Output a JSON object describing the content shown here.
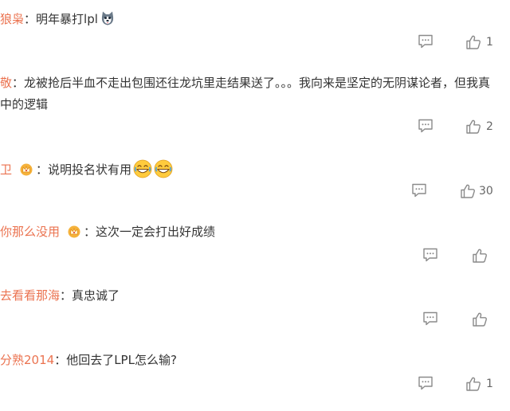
{
  "comments": [
    {
      "user": "狼枭",
      "sep": "：",
      "text": "明年暴打lpl",
      "text2": "",
      "likes": "1"
    },
    {
      "user": "敬",
      "sep": "：",
      "text": "龙被抢后半血不走出包围还往龙坑里走结果送了。。。我向来是坚定的无阴谋论者，但我真",
      "text2": "中的逻辑",
      "likes": "2"
    },
    {
      "user": "卫",
      "sep": "：",
      "text": "说明投名状有用",
      "text2": "",
      "likes": "30"
    },
    {
      "user": "你那么没用",
      "sep": "：",
      "text": "这次一定会打出好成绩",
      "text2": "",
      "likes": ""
    },
    {
      "user": "去看看那海",
      "sep": "：",
      "text": "真忠诚了",
      "text2": "",
      "likes": ""
    },
    {
      "user": "分熟2014",
      "sep": "：",
      "text": "他回去了LPL怎么输?",
      "text2": "",
      "likes": "1"
    }
  ],
  "icons": {
    "reply": "comment-bubble-icon",
    "like": "thumbs-up-icon",
    "badge": "crown-badge-icon",
    "emoji": "grinning-emoji-icon",
    "avatar_sticker": "husky-emoji-icon"
  },
  "colors": {
    "username": "#eb7350",
    "text": "#333333",
    "icon": "#8a8a8a"
  }
}
